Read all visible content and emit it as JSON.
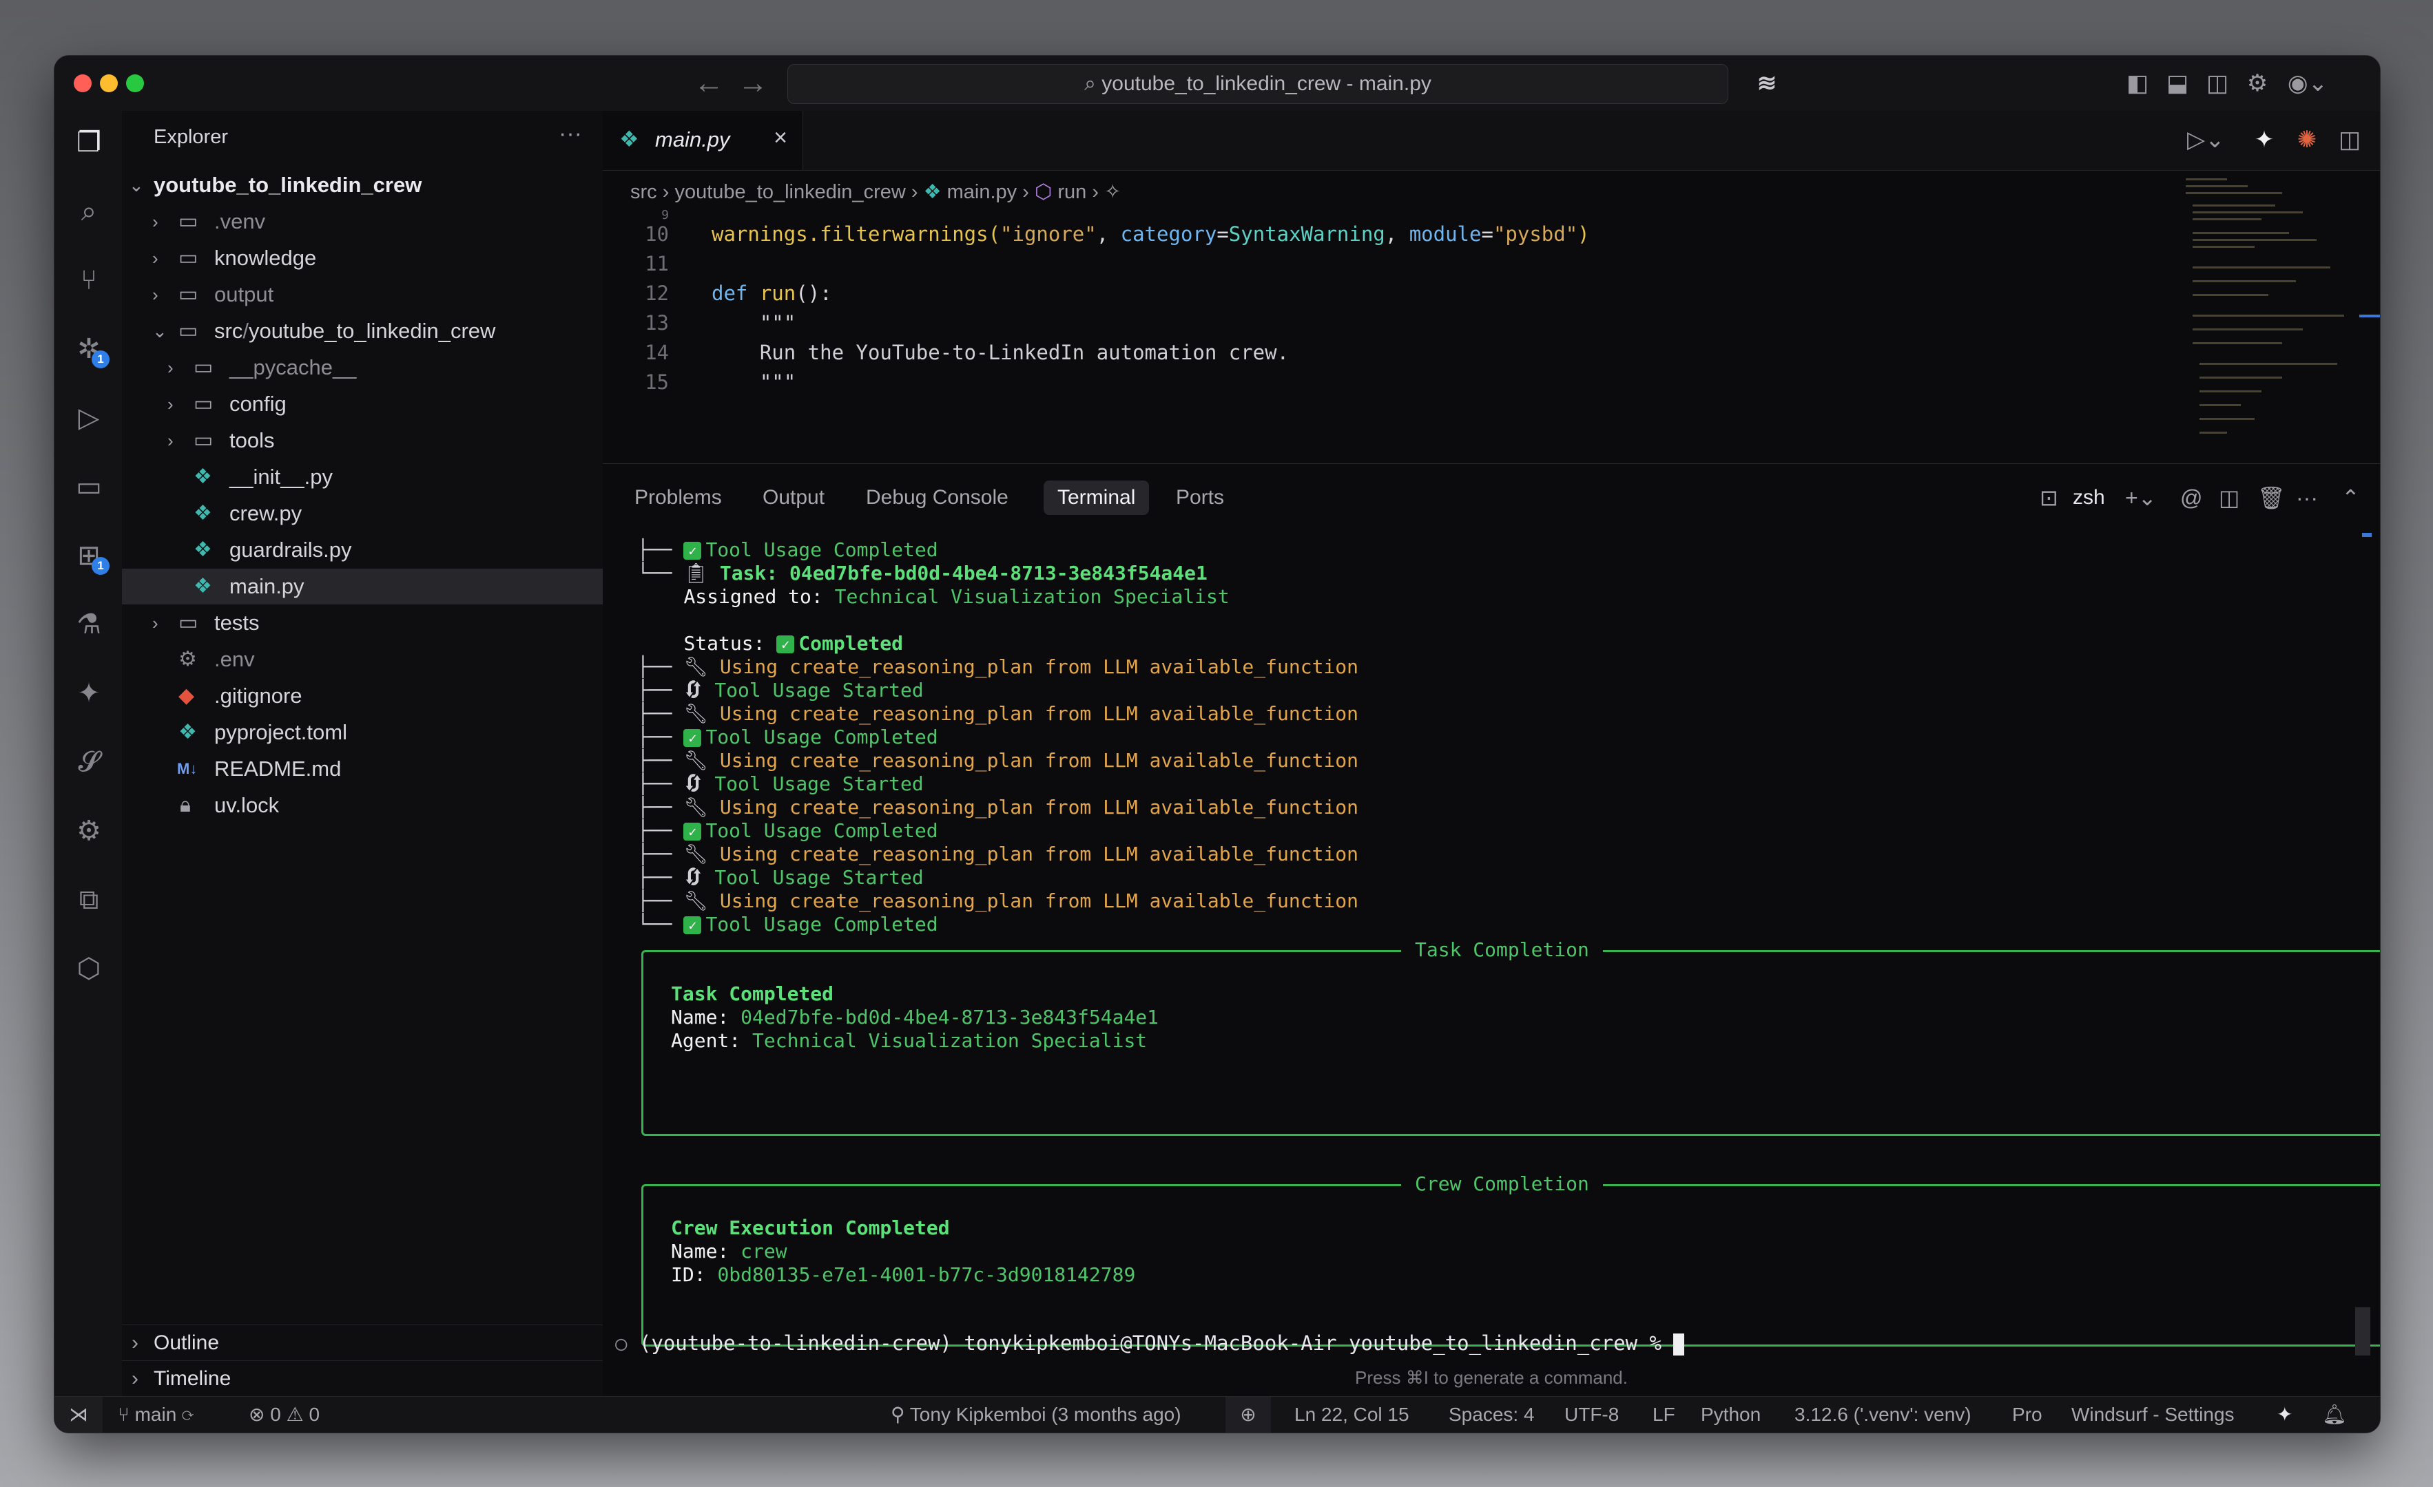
{
  "window": {
    "title": "youtube_to_linkedin_crew - main.py"
  },
  "titlebar": {
    "search_icon": "search-icon",
    "logo": "windsurf-logo"
  },
  "sidebar": {
    "title": "Explorer",
    "root": "youtube_to_linkedin_crew",
    "items": [
      {
        "label": ".venv",
        "kind": "folder",
        "dim": true
      },
      {
        "label": "knowledge",
        "kind": "folder"
      },
      {
        "label": "output",
        "kind": "folder",
        "dim": true
      },
      {
        "label": "src",
        "sep": "/",
        "label2": "youtube_to_linkedin_crew",
        "kind": "folder-open"
      },
      {
        "label": "__pycache__",
        "kind": "folder",
        "dim": true
      },
      {
        "label": "config",
        "kind": "folder"
      },
      {
        "label": "tools",
        "kind": "folder"
      },
      {
        "label": "__init__.py",
        "kind": "python"
      },
      {
        "label": "crew.py",
        "kind": "python"
      },
      {
        "label": "guardrails.py",
        "kind": "python"
      },
      {
        "label": "main.py",
        "kind": "python",
        "selected": true
      },
      {
        "label": "tests",
        "kind": "folder"
      },
      {
        "label": ".env",
        "kind": "settings",
        "dim": true
      },
      {
        "label": ".gitignore",
        "kind": "git"
      },
      {
        "label": "pyproject.toml",
        "kind": "python"
      },
      {
        "label": "README.md",
        "kind": "markdown"
      },
      {
        "label": "uv.lock",
        "kind": "lock"
      }
    ],
    "outline": "Outline",
    "timeline": "Timeline"
  },
  "editor": {
    "tab": "main.py",
    "breadcrumb": [
      "src",
      "youtube_to_linkedin_crew",
      "main.py",
      "run"
    ],
    "lines": [
      {
        "n": "9",
        "text": ""
      },
      {
        "n": "10",
        "text": ""
      },
      {
        "n": "11",
        "text": ""
      },
      {
        "n": "12",
        "text": ""
      },
      {
        "n": "13",
        "text": ""
      },
      {
        "n": "14",
        "text": ""
      },
      {
        "n": "15",
        "text": ""
      }
    ],
    "code": {
      "l10a": "warnings.filterwarnings(",
      "l10b": "\"ignore\"",
      "l10c": ", ",
      "l10d": "category",
      "l10e": "=",
      "l10f": "SyntaxWarning",
      "l10g": ", ",
      "l10h": "module",
      "l10i": "=",
      "l10j": "\"pysbd\"",
      "l10k": ")",
      "l12a": "def ",
      "l12b": "run",
      "l12c": "():",
      "l13": "    \"\"\"",
      "l14": "    Run the YouTube-to-LinkedIn automation crew.",
      "l15": "    \"\"\""
    }
  },
  "panel": {
    "tabs": [
      "Problems",
      "Output",
      "Debug Console",
      "Terminal",
      "Ports"
    ],
    "active_tab": "Terminal",
    "shell": "zsh"
  },
  "terminal": {
    "tool_completed": "Tool Usage Completed",
    "tool_started": "Tool Usage Started",
    "using": "Using create_reasoning_plan from LLM available_function",
    "task_label": "Task: 04ed7bfe-bd0d-4be4-8713-3e843f54a4e1",
    "assigned_label": "Assigned to: ",
    "assigned_value": "Technical Visualization Specialist",
    "status_label": "Status: ",
    "status_value": "Completed",
    "task_box": {
      "title": "Task Completion",
      "heading": "Task Completed",
      "name_label": "Name: ",
      "name_value": "04ed7bfe-bd0d-4be4-8713-3e843f54a4e1",
      "agent_label": "Agent: ",
      "agent_value": "Technical Visualization Specialist"
    },
    "crew_box": {
      "title": "Crew Completion",
      "heading": "Crew Execution Completed",
      "name_label": "Name: ",
      "name_value": "crew",
      "id_label": "ID: ",
      "id_value": "0bd80135-e7e1-4001-b77c-3d9018142789"
    },
    "prompt": "(youtube-to-linkedin-crew) tonykipkemboi@TONYs-MacBook-Air youtube_to_linkedin_crew % ",
    "hint": "Press ⌘I to generate a command."
  },
  "statusbar": {
    "branch": "main",
    "errors": "0",
    "warnings": "0",
    "blame": "Tony Kipkemboi (3 months ago)",
    "position": "Ln 22, Col 15",
    "spaces": "Spaces: 4",
    "encoding": "UTF-8",
    "eol": "LF",
    "language": "Python",
    "interpreter": "3.12.6 ('.venv': venv)",
    "plan": "Pro",
    "settings": "Windsurf - Settings"
  },
  "colors": {
    "accent_green": "#4fc56a",
    "accent_orange": "#e3a54a",
    "badge_blue": "#2f7fe8"
  }
}
